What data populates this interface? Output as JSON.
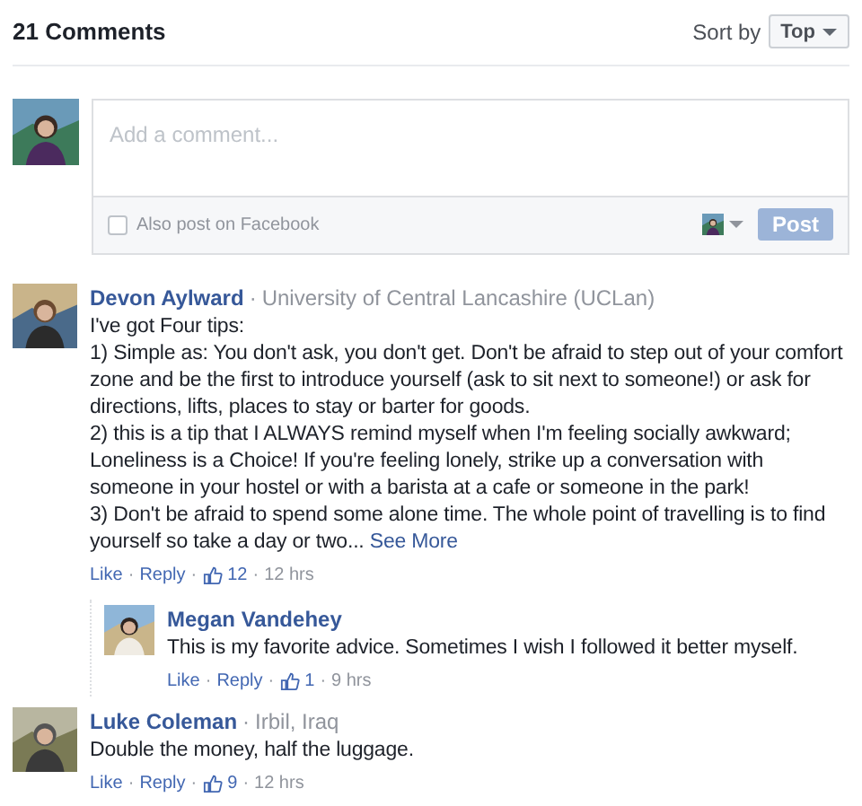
{
  "separator": "·",
  "header": {
    "count_title": "21 Comments",
    "sort_label": "Sort by",
    "sort_value": "Top"
  },
  "composer": {
    "placeholder": "Add a comment...",
    "also_post": {
      "label": "Also post on Facebook",
      "checked": false
    },
    "post_button": {
      "label": "Post",
      "disabled": true
    }
  },
  "comments": [
    {
      "author": "Devon Aylward",
      "affiliation": "University of Central Lancashire (UCLan)",
      "paragraphs": [
        "I've got Four tips:",
        "1) Simple as: You don't ask, you don't get. Don't be afraid to step out of your comfort zone and be the first to introduce yourself (ask to sit next to someone!) or ask for directions, lifts, places to stay or barter for goods.",
        "2) this is a tip that I ALWAYS remind myself when I'm feeling socially awkward; Loneliness is a Choice! If you're feeling lonely, strike up a conversation with someone in your hostel or with a barista at a cafe or someone in the park!",
        "3) Don't be afraid to spend some alone time. The whole point of travelling is to find yourself so take a day or two..."
      ],
      "see_more": "See More",
      "like": "Like",
      "reply": "Reply",
      "likes": "12",
      "time": "12 hrs",
      "replies": [
        {
          "author": "Megan Vandehey",
          "paragraphs": [
            "This is my favorite advice. Sometimes I wish I followed it better myself."
          ],
          "like": "Like",
          "reply": "Reply",
          "likes": "1",
          "time": "9 hrs"
        }
      ]
    },
    {
      "author": "Luke Coleman",
      "affiliation": "Irbil, Iraq",
      "paragraphs": [
        "Double the money, half the luggage."
      ],
      "like": "Like",
      "reply": "Reply",
      "likes": "9",
      "time": "12 hrs"
    }
  ]
}
